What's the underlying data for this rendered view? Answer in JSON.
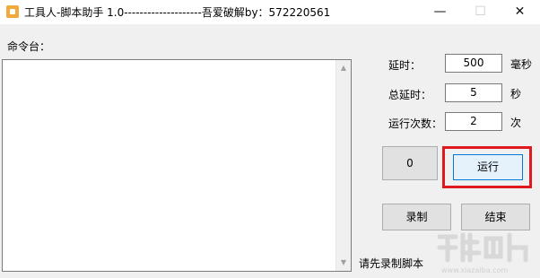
{
  "window": {
    "title": "工具人-脚本助手 1.0--------------------吾爱破解by：572220561",
    "controls": {
      "minimize": "—",
      "maximize": "☐",
      "close": "✕"
    }
  },
  "console": {
    "label": "命令台：",
    "content": ""
  },
  "settings": {
    "delay_label": "延时：",
    "delay_value": "500",
    "delay_unit": "毫秒",
    "total_delay_label": "总延时：",
    "total_delay_value": "5",
    "total_delay_unit": "秒",
    "run_count_label": "运行次数：",
    "run_count_value": "2",
    "run_count_unit": "次"
  },
  "buttons": {
    "counter_label": "0",
    "run_label": "运行",
    "record_label": "录制",
    "stop_label": "结束"
  },
  "status": {
    "text": "请先录制脚本"
  },
  "colors": {
    "highlight": "#e0191e",
    "primary_border": "#0078d7",
    "app_icon": "#f2a93b"
  }
}
